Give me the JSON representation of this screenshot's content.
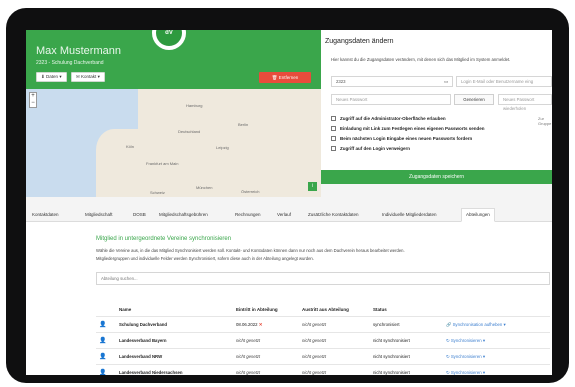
{
  "header": {
    "name": "Max Mustermann",
    "subtitle": "2323 - Schulung Dachverband",
    "logo_text": "dV",
    "buttons": {
      "daten": "Daten",
      "kontakt": "Kontakt",
      "entfernen": "Entfernen"
    }
  },
  "map": {
    "labels": [
      "Deutschland",
      "Berlin",
      "Hamburg",
      "Frankfurt am Main",
      "Köln",
      "Leipzig",
      "München",
      "Österreich",
      "Schweiz"
    ]
  },
  "access": {
    "title": "Zugangsdaten ändern",
    "description": "Hier kannst du die Zugangsdaten verändern, mit denen sich das Mitglied im System anmeldet.",
    "user_value": "2323",
    "login_placeholder": "Login E-Mail oder Benutzername eing",
    "new_password_placeholder": "Neues Passwort",
    "generate_label": "Generieren",
    "repeat_password_placeholder": "Neues Passwort wiederholen",
    "checkboxes": [
      "Zugriff auf die Administrator-Oberfläche erlauben",
      "Einladung mit Link zum Festlegen eines eigenen Passworts senden",
      "Beim nächsten Login Eingabe eines neuen Passworts fordern",
      "Zugriff auf den Login verweigern"
    ],
    "group_note": "Zur Gruppe",
    "save_label": "Zugangsdaten speichern"
  },
  "tabs": [
    "Kontaktdaten",
    "Mitgliedschaft",
    "DOSB",
    "Mitgliedschaftsgebühren",
    "Rechnungen",
    "Verlauf",
    "Zusätzliche Kontaktdaten",
    "Individuelle Mitgliederdaten",
    "Abteilungen"
  ],
  "section": {
    "title": "Mitglied in untergeordnete Vereine synchronisieren",
    "desc1": "Wähle die Vereine aus, in die das Mitglied Synchronisiert werden soll. Kontakt- und Kontodaten können dann nur noch aus dem Dachverein heraus bearbeitet werden.",
    "desc2": "Mitgliedergruppen und individuelle Felder werden Synchronisiert, sofern diese auch in der Abteilung angelegt wurden.",
    "search_placeholder": "Abteilung suchen..."
  },
  "table": {
    "headers": [
      "Name",
      "Eintritt in Abteilung",
      "Austritt aus Abteilung",
      "Status"
    ],
    "rows": [
      {
        "name": "Schulung Dachverband",
        "eintritt": "08.06.2022",
        "austritt": "nicht gesetzt",
        "status": "synchronisiert",
        "action": "Synchronisation aufheben"
      },
      {
        "name": "Landesverband Bayern",
        "eintritt": "nicht gesetzt",
        "austritt": "nicht gesetzt",
        "status": "nicht synchronisiert",
        "action": "Synchronisieren"
      },
      {
        "name": "Landesverband NRW",
        "eintritt": "nicht gesetzt",
        "austritt": "nicht gesetzt",
        "status": "nicht synchronisiert",
        "action": "Synchronisieren"
      },
      {
        "name": "Landesverband Niedersachsen",
        "eintritt": "nicht gesetzt",
        "austritt": "nicht gesetzt",
        "status": "nicht synchronisiert",
        "action": "Synchronisieren"
      }
    ]
  },
  "colors": {
    "brand_green": "#3aa64b",
    "danger_red": "#e74c3c",
    "link_blue": "#3b7ecf"
  }
}
